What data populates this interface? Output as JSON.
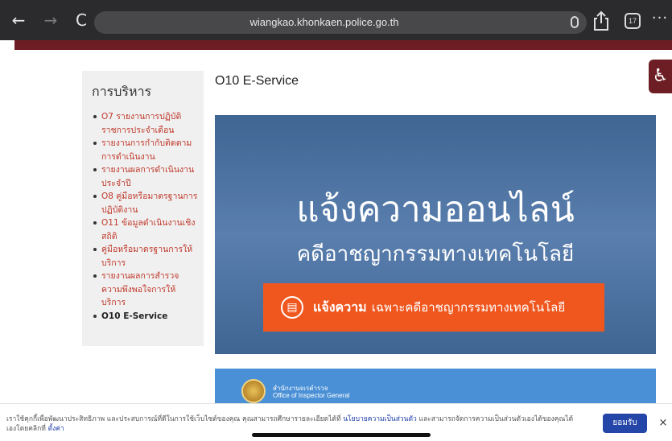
{
  "browser": {
    "back": "←",
    "forward": "→",
    "reload": "C",
    "url": "wiangkao.khonkaen.police.go.th",
    "tab_count": "17",
    "more": "···"
  },
  "accessibility_icon": "♿",
  "sidebar": {
    "title": "การบริหาร",
    "items": [
      {
        "label": "O7 รายงานการปฏิบัติราชการประจำเดือน"
      },
      {
        "label": "รายงานการกำกับติดตามการดำเนินงาน"
      },
      {
        "label": "รายงานผลการดำเนินงานประจำปี"
      },
      {
        "label": "O8 คู่มือหรือมาตรฐานการปฏิบัติงาน"
      },
      {
        "label": "O11 ข้อมูลดำเนินงานเชิงสถิติ"
      },
      {
        "label": "คู่มือหรือมาตรฐานการให้บริการ"
      },
      {
        "label": "รายงานผลการสำรวจความพึงพอใจการให้บริการ"
      },
      {
        "label": "O10 E-Service"
      }
    ]
  },
  "main": {
    "title": "O10 E-Service"
  },
  "banner": {
    "headline": "แจ้งความออนไลน์",
    "subline": "คดีอาชญากรรมทางเทคโนโลยี",
    "cta_strong": "แจ้งความ",
    "cta_rest": "เฉพาะคดีอาชญากรรมทางเทคโนโลยี",
    "colors": {
      "background": "#4a6f9e",
      "cta": "#f0571f"
    }
  },
  "second_banner": {
    "office_th": "สำนักงานจเรตำรวจ",
    "office_en": "Office of Inspector General"
  },
  "cookie": {
    "text_before": "เราใช้คุกกี้เพื่อพัฒนาประสิทธิภาพ และประสบการณ์ที่ดีในการใช้เว็บไซต์ของคุณ คุณสามารถศึกษารายละเอียดได้ที่ ",
    "policy_link": "นโยบายความเป็นส่วนตัว",
    "text_after": " และสามารถจัดการความเป็นส่วนตัวเองได้ของคุณได้เองโดยคลิกที่ ",
    "settings_link": "ตั้งค่า",
    "accept": "ยอมรับ",
    "close": "×"
  }
}
